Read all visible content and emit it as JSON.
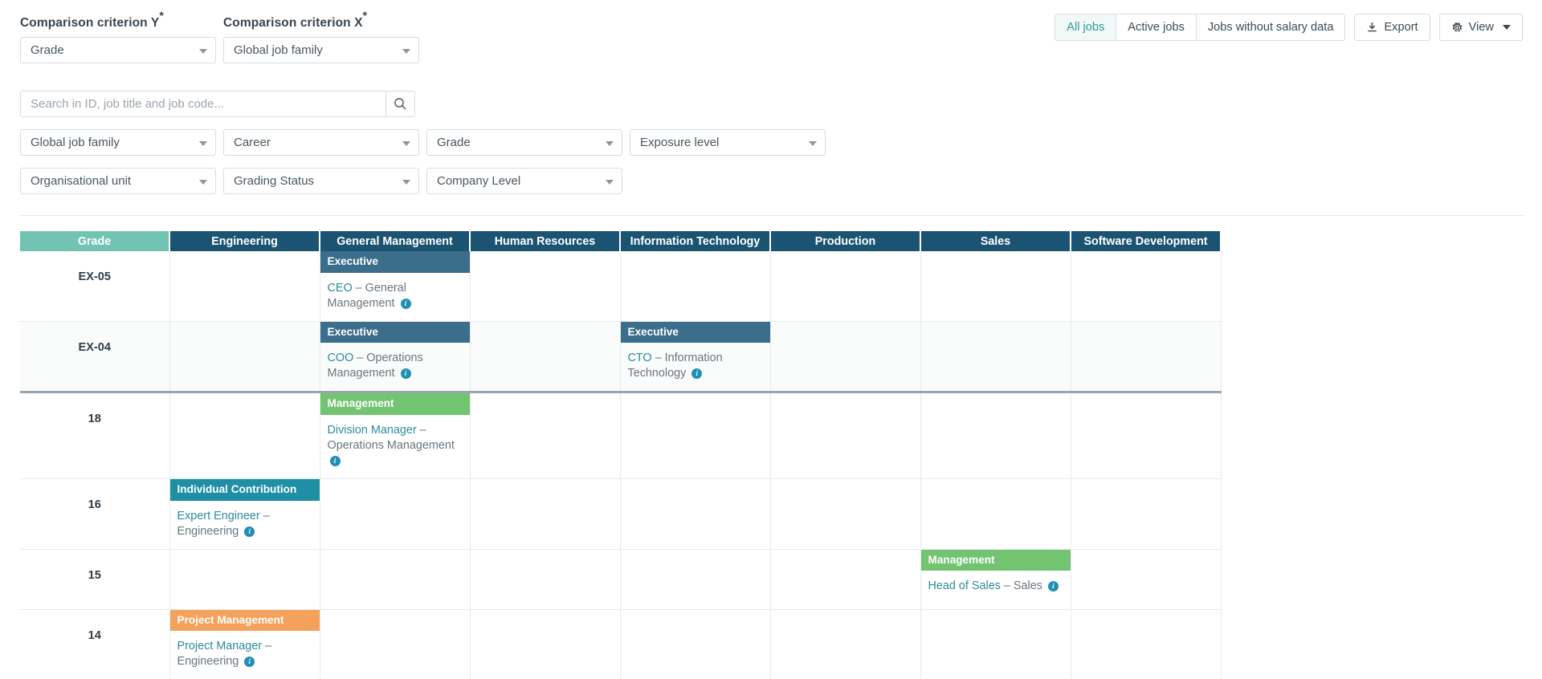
{
  "criteria": {
    "y": {
      "label": "Comparison criterion Y",
      "required": "*",
      "value": "Grade"
    },
    "x": {
      "label": "Comparison criterion X",
      "required": "*",
      "value": "Global job family"
    }
  },
  "toolbar": {
    "segments": [
      {
        "label": "All jobs",
        "active": true
      },
      {
        "label": "Active jobs",
        "active": false
      },
      {
        "label": "Jobs without salary data",
        "active": false
      }
    ],
    "export_label": "Export",
    "export_icon": "download-icon",
    "view_label": "View",
    "view_icon": "gear-icon",
    "caret_icon": "chevron-down-icon",
    "active_color": "#2a9d9a"
  },
  "search": {
    "placeholder": "Search in ID, job title and job code...",
    "value": "",
    "button_icon": "search-icon"
  },
  "filters": {
    "row1": [
      "Global job family",
      "Career",
      "Grade",
      "Exposure level"
    ],
    "row2": [
      "Organisational unit",
      "Grading Status",
      "Company Level"
    ]
  },
  "table": {
    "grade_header": "Grade",
    "columns": [
      "Engineering",
      "General Management",
      "Human Resources",
      "Information Technology",
      "Production",
      "Sales",
      "Software Development"
    ],
    "header_colors": {
      "grade": "#72c3b2",
      "family": "#1b5472"
    },
    "badge_colors": {
      "Executive": "#3a6e8b",
      "Management": "#72c471",
      "Individual Contribution": "#1e8fa5",
      "Project Management": "#f4a15c"
    },
    "rows": [
      {
        "grade": "EX-05",
        "alt": false,
        "thick_sep": false,
        "cells": [
          null,
          {
            "badge": "Executive",
            "badge_type": "executive",
            "job_title": "CEO",
            "job_family": "General Management"
          },
          null,
          null,
          null,
          null,
          null
        ]
      },
      {
        "grade": "EX-04",
        "alt": true,
        "thick_sep": true,
        "cells": [
          null,
          {
            "badge": "Executive",
            "badge_type": "executive",
            "job_title": "COO",
            "job_family": "Operations Management"
          },
          null,
          {
            "badge": "Executive",
            "badge_type": "executive",
            "job_title": "CTO",
            "job_family": "Information Technology"
          },
          null,
          null,
          null
        ]
      },
      {
        "grade": "18",
        "alt": false,
        "thick_sep": false,
        "cells": [
          null,
          {
            "badge": "Management",
            "badge_type": "management",
            "job_title": "Division Manager",
            "job_family": "Operations Management"
          },
          null,
          null,
          null,
          null,
          null
        ]
      },
      {
        "grade": "16",
        "alt": false,
        "thick_sep": false,
        "cells": [
          {
            "badge": "Individual Contribution",
            "badge_type": "individual",
            "job_title": "Expert Engineer",
            "job_family": "Engineering"
          },
          null,
          null,
          null,
          null,
          null,
          null
        ]
      },
      {
        "grade": "15",
        "alt": false,
        "thick_sep": false,
        "cells": [
          null,
          null,
          null,
          null,
          null,
          {
            "badge": "Management",
            "badge_type": "management",
            "job_title": "Head of Sales",
            "job_family": "Sales"
          },
          null
        ]
      },
      {
        "grade": "14",
        "alt": false,
        "thick_sep": false,
        "cells": [
          {
            "badge": "Project Management",
            "badge_type": "project",
            "job_title": "Project Manager",
            "job_family": "Engineering"
          },
          null,
          null,
          null,
          null,
          null,
          null
        ]
      }
    ],
    "dash": "–",
    "info_icon": "info-icon"
  }
}
